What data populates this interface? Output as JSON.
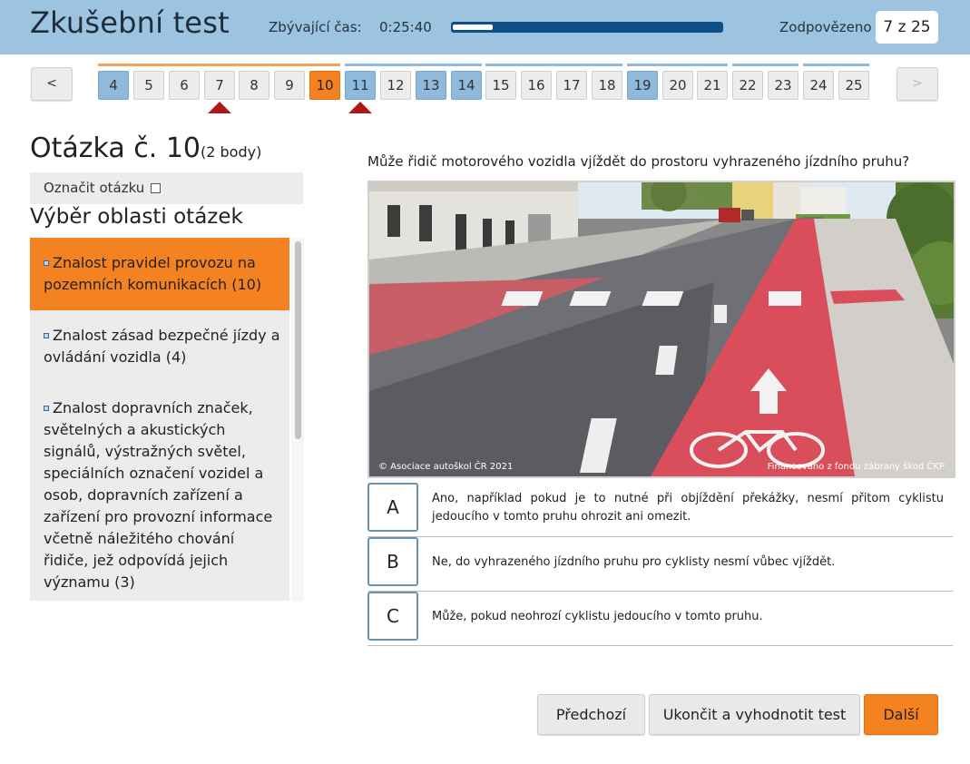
{
  "header": {
    "title": "Zkušební test",
    "time_label": "Zbývající čas:",
    "time_value": "0:25:40",
    "time_progress": 0.15,
    "answered_label": "Zodpovězeno",
    "answered_value": "7 z 25"
  },
  "nav": {
    "prev_label": "<",
    "next_label": ">",
    "questions": [
      {
        "num": "4",
        "state": "answered"
      },
      {
        "num": "5",
        "state": "default"
      },
      {
        "num": "6",
        "state": "default"
      },
      {
        "num": "7",
        "state": "default",
        "marker": true
      },
      {
        "num": "8",
        "state": "default"
      },
      {
        "num": "9",
        "state": "default"
      },
      {
        "num": "10",
        "state": "current"
      },
      {
        "num": "11",
        "state": "answered",
        "marker": true
      },
      {
        "num": "12",
        "state": "default"
      },
      {
        "num": "13",
        "state": "answered"
      },
      {
        "num": "14",
        "state": "answered"
      },
      {
        "num": "15",
        "state": "default"
      },
      {
        "num": "16",
        "state": "default"
      },
      {
        "num": "17",
        "state": "default"
      },
      {
        "num": "18",
        "state": "default"
      },
      {
        "num": "19",
        "state": "answered"
      },
      {
        "num": "20",
        "state": "default"
      },
      {
        "num": "21",
        "state": "default"
      },
      {
        "num": "22",
        "state": "default"
      },
      {
        "num": "23",
        "state": "default"
      },
      {
        "num": "24",
        "state": "default"
      },
      {
        "num": "25",
        "state": "default"
      }
    ],
    "colors": {
      "answered": "#8fbadc",
      "current": "#f58220",
      "marker": "#b01818"
    }
  },
  "question": {
    "title": "Otázka č. 10",
    "points": "(2 body)",
    "mark_label": "Označit otázku",
    "text": "Může řidič motorového vozidla vjíždět do prostoru vyhrazeného jízdního pruhu?",
    "photo_credit_left": "© Asociace autoškol ČR 2021",
    "photo_credit_right": "Financováno z fondu zábrany škod ČKP"
  },
  "areas": {
    "title": "Výběr oblasti otázek",
    "items": [
      {
        "label": "Znalost pravidel provozu na pozemních komunikacích (10)",
        "active": true
      },
      {
        "label": "Znalost zásad bezpečné jízdy a ovládání vozidla (4)",
        "active": false
      },
      {
        "label": "Znalost dopravních značek, světelných a akustických signálů, výstražných světel, speciálních označení vozidel a osob, dopravních zařízení a zařízení pro provozní informace včetně náležitého chování řidiče, jež odpovídá jejich významu (3)",
        "active": false
      }
    ]
  },
  "answers": [
    {
      "letter": "A",
      "text": "Ano, například pokud je to nutné při objíždění překážky, nesmí přitom cyklistu jedoucího v tomto pruhu ohrozit ani omezit."
    },
    {
      "letter": "B",
      "text": "Ne, do vyhrazeného jízdního pruhu pro cyklisty nesmí vůbec vjíždět."
    },
    {
      "letter": "C",
      "text": "Může, pokud neohrozí cyklistu jedoucího v tomto pruhu."
    }
  ],
  "buttons": {
    "previous": "Předchozí",
    "finish": "Ukončit a vyhodnotit test",
    "next": "Další"
  }
}
